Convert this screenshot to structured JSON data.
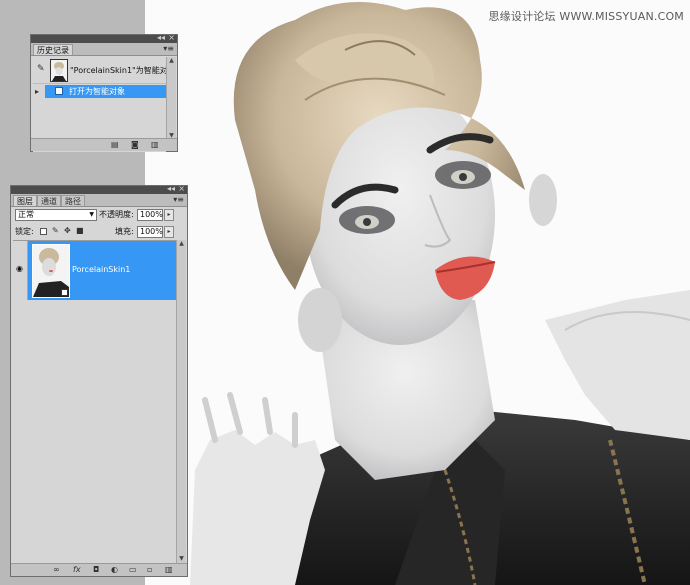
{
  "watermark": "思缘设计论坛 WWW.MISSYUAN.COM",
  "history_panel": {
    "tab": "历史记录",
    "snapshot_label": "\"PorcelainSkin1\"为智能对...",
    "state_label": "打开为智能对象"
  },
  "layers_panel": {
    "tabs": [
      "图层",
      "通道",
      "路径"
    ],
    "blend_mode": "正常",
    "opacity_label": "不透明度:",
    "opacity_value": "100%",
    "lock_label": "锁定:",
    "fill_label": "填充:",
    "fill_value": "100%",
    "layer_name": "PorcelainSkin1"
  },
  "footer_icons": [
    "link-icon",
    "fx-icon",
    "mask-icon",
    "adjustment-icon",
    "group-icon",
    "new-layer-icon",
    "trash-icon"
  ],
  "colors": {
    "selection": "#3797f5",
    "panel_bg": "#d6d6d6"
  }
}
